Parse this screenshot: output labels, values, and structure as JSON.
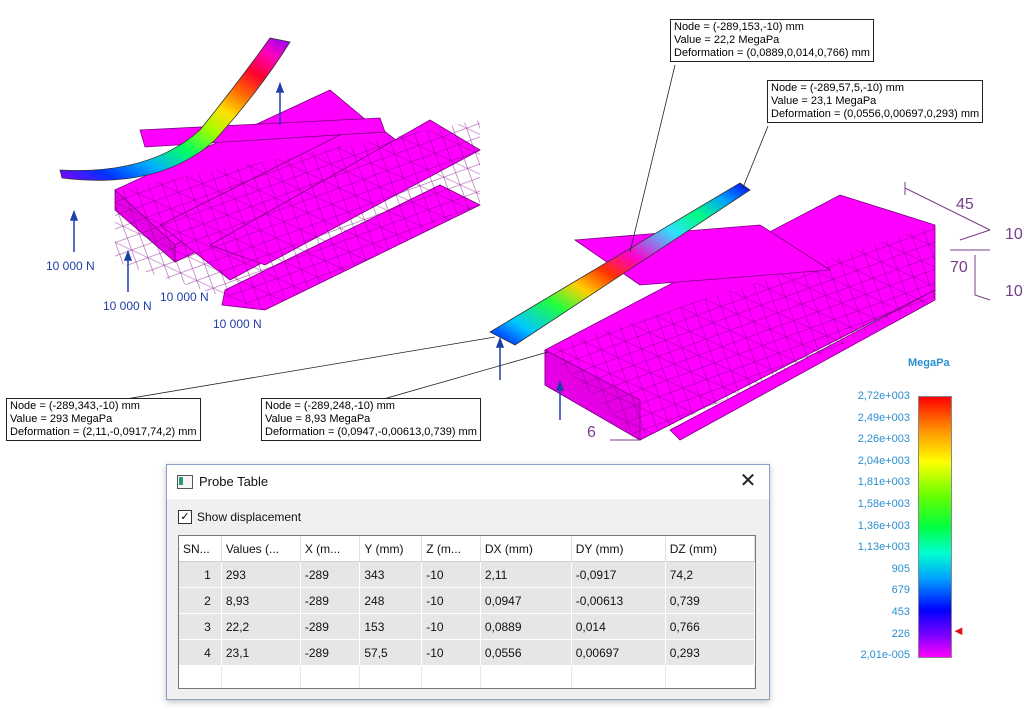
{
  "probes": [
    {
      "node": "Node = (-289,153,-10) mm",
      "value": "Value = 22,2 MegaPa",
      "deformation": "Deformation = (0,0889,0,014,0,766) mm"
    },
    {
      "node": "Node = (-289,57,5,-10) mm",
      "value": "Value = 23,1 MegaPa",
      "deformation": "Deformation = (0,0556,0,00697,0,293) mm"
    },
    {
      "node": "Node = (-289,343,-10) mm",
      "value": "Value = 293 MegaPa",
      "deformation": "Deformation = (2,11,-0,0917,74,2) mm"
    },
    {
      "node": "Node = (-289,248,-10) mm",
      "value": "Value = 8,93 MegaPa",
      "deformation": "Deformation = (0,0947,-0,00613,0,739) mm"
    }
  ],
  "forces": [
    "10 000 N",
    "10 000 N",
    "10 000 N",
    "10 000 N"
  ],
  "dimensions": {
    "d45": "45",
    "d10a": "10",
    "d70": "70",
    "d10b": "10",
    "d6": "6"
  },
  "legend": {
    "unit": "MegaPa",
    "ticks": [
      "2,72e+003",
      "2,49e+003",
      "2,26e+003",
      "2,04e+003",
      "1,81e+003",
      "1,58e+003",
      "1,36e+003",
      "1,13e+003",
      "905",
      "679",
      "453",
      "226",
      "2,01e-005"
    ],
    "marker_color": "#e0101a"
  },
  "dialog": {
    "title": "Probe Table",
    "close_icon": "close-icon",
    "show_displacement_label": "Show displacement",
    "show_displacement_checked": true,
    "columns": [
      "SN...",
      "Values (...",
      "X (m...",
      "Y (mm)",
      "Z (m...",
      "DX (mm)",
      "DY (mm)",
      "DZ (mm)"
    ],
    "rows": [
      [
        "1",
        "293",
        "-289",
        "343",
        "-10",
        "2,11",
        "-0,0917",
        "74,2"
      ],
      [
        "2",
        "8,93",
        "-289",
        "248",
        "-10",
        "0,0947",
        "-0,00613",
        "0,739"
      ],
      [
        "3",
        "22,2",
        "-289",
        "153",
        "-10",
        "0,0889",
        "0,014",
        "0,766"
      ],
      [
        "4",
        "23,1",
        "-289",
        "57,5",
        "-10",
        "0,0556",
        "0,00697",
        "0,293"
      ]
    ]
  },
  "colors": {
    "magenta": "#ff00ff",
    "force_blue": "#1f3fa8",
    "dim_purple": "#7a3d8c",
    "legend_text": "#2b8fd0"
  }
}
